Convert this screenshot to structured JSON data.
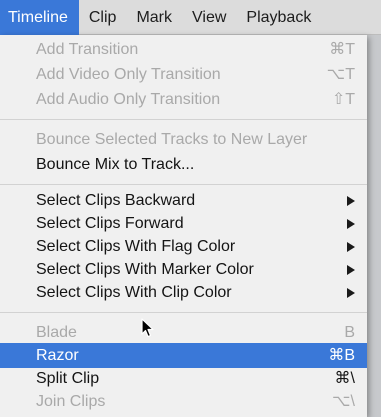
{
  "menubar": {
    "items": [
      {
        "label": "Timeline",
        "active": true
      },
      {
        "label": "Clip",
        "active": false
      },
      {
        "label": "Mark",
        "active": false
      },
      {
        "label": "View",
        "active": false
      },
      {
        "label": "Playback",
        "active": false
      }
    ]
  },
  "menu": {
    "add_transition": {
      "label": "Add Transition",
      "shortcut": "⌘T",
      "enabled": false
    },
    "add_video_only_transition": {
      "label": "Add Video Only Transition",
      "shortcut": "⌥T",
      "enabled": false
    },
    "add_audio_only_transition": {
      "label": "Add Audio Only Transition",
      "shortcut": "⇧T",
      "enabled": false
    },
    "bounce_selected_tracks": {
      "label": "Bounce Selected Tracks to New Layer",
      "enabled": false
    },
    "bounce_mix_to_track": {
      "label": "Bounce Mix to Track...",
      "enabled": true
    },
    "select_clips_backward": {
      "label": "Select Clips Backward",
      "submenu": true
    },
    "select_clips_forward": {
      "label": "Select Clips Forward",
      "submenu": true
    },
    "select_clips_flag_color": {
      "label": "Select Clips With Flag Color",
      "submenu": true
    },
    "select_clips_marker_color": {
      "label": "Select Clips With Marker Color",
      "submenu": true
    },
    "select_clips_clip_color": {
      "label": "Select Clips With Clip Color",
      "submenu": true
    },
    "blade": {
      "label": "Blade",
      "shortcut": "B",
      "enabled": false
    },
    "razor": {
      "label": "Razor",
      "shortcut": "⌘B",
      "enabled": true,
      "highlighted": true
    },
    "split_clip": {
      "label": "Split Clip",
      "shortcut": "⌘\\",
      "enabled": true
    },
    "join_clips": {
      "label": "Join Clips",
      "shortcut": "⌥\\",
      "enabled": false
    }
  },
  "colors": {
    "highlight": "#3a78d8",
    "menu_background": "#f0f0f0",
    "disabled_text": "#a9a9a9",
    "text": "#141414"
  }
}
